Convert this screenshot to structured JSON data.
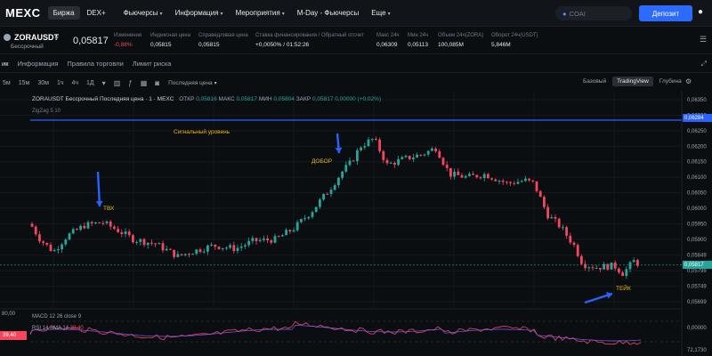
{
  "nav": {
    "logo": "MEXC",
    "tab_exchange": "Биржа",
    "tab_dex": "DEX+",
    "items": [
      "Фьючерсы",
      "Информация",
      "Мероприятия",
      "M-Day - Фьючерсы",
      "Еще"
    ],
    "search_placeholder": "COAI",
    "deposit_label": "Депозит"
  },
  "ticker": {
    "pair": "ZORAUSDT",
    "pair_sub": "Бессрочный",
    "last_price": "0,05817",
    "stats": [
      {
        "label": "Изменение",
        "value": "-0,88%"
      },
      {
        "label": "Индексная цена",
        "value": "0,05815"
      },
      {
        "label": "Справедливая цена",
        "value": "0,05815"
      },
      {
        "label": "Ставка финансирования / Обратный отсчет",
        "value": "+0,0050% / 01:52:26"
      },
      {
        "label": "Макс 24ч",
        "value": "0,06309"
      },
      {
        "label": "Мин 24ч",
        "value": "0,05113"
      },
      {
        "label": "Объем 24ч(ZORA)",
        "value": "100,085M"
      },
      {
        "label": "Оборот 24ч(USDT)",
        "value": "5,846M"
      }
    ]
  },
  "subtabs": [
    "ик",
    "Информация",
    "Правила торговли",
    "Лимит риска"
  ],
  "toolbar": {
    "timeframes": [
      "5м",
      "15м",
      "30м",
      "1ч",
      "4ч",
      "1Д"
    ],
    "price_type": "Последняя цена",
    "views": [
      "Базовый",
      "TradingView",
      "Глубина"
    ]
  },
  "chart": {
    "legend": "ZORAUSDT Бессрочный Последняя цена · 1 · MEXC",
    "ohlc": {
      "open_label": "ОТКР",
      "open": "0,05816",
      "high_label": "МАКС",
      "high": "0,05817",
      "low_label": "МИН",
      "low": "0,05804",
      "close_label": "ЗАКР",
      "close": "0,05817",
      "change": "0,00000 (+0,02%)"
    },
    "zigzag_legend": "ZigZag 5 10",
    "annotations": {
      "signal": "Сигнальный уровень",
      "tvh": "ТВХ",
      "dobor": "ДОБОР",
      "take": "ТЕЙК"
    },
    "price_ticks": [
      "0,06350",
      "0,06300",
      "0,06250",
      "0,06200",
      "0,06150",
      "0,06100",
      "0,06050",
      "0,06000",
      "0,05950",
      "0,05900",
      "0,05849",
      "0,05799",
      "0,05749",
      "0,05699"
    ],
    "signal_level": "0,06284",
    "current_price": "0,05817",
    "macd_legend": "MACD 12 26 close 9",
    "rsi_legend": "RSI 14 SMA 14",
    "rsi_value": "39,40",
    "rsi_box": "39,40",
    "osc_left_top": "80,00",
    "osc_right_zero": "0,00000",
    "osc_right_bottom": "72,1730",
    "colors": {
      "up": "#26a69a",
      "down": "#f6465d",
      "signal_line": "#2962ff",
      "annotation": "#f0b90b",
      "arrow": "#2962ff"
    }
  }
}
